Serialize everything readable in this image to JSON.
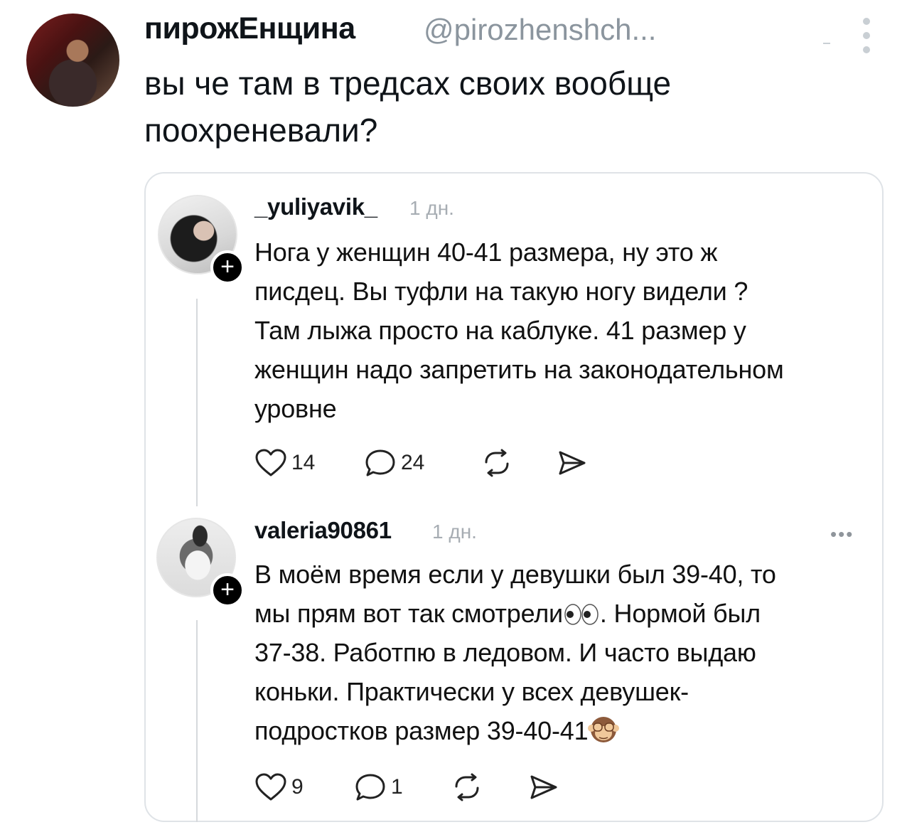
{
  "tweet": {
    "author_name": "пирожЕнщина",
    "author_handle": "@pirozhenshch...",
    "text_line1": "вы че там в тредсах своих вообще",
    "text_line2": "поохреневали?"
  },
  "quote": {
    "replies": [
      {
        "username": "_yuliyavik_",
        "time": "1 дн.",
        "follow_label": "+",
        "lines": [
          "Нога у женщин 40-41 размера, ну это ж",
          "писдец. Вы туфли на такую ногу видели ?",
          "Там лыжа просто на каблуке. 41 размер у",
          "женщин надо запретить на законодательном",
          "уровне"
        ],
        "likes": "14",
        "comments": "24"
      },
      {
        "username": "valeria90861",
        "time": "1 дн.",
        "follow_label": "+",
        "more": "•••",
        "lines": [
          "В моём время если у девушки был 39-40, то",
          "мы прям вот так смотрели",
          ". Нормой был",
          "37-38. Работпю в ледовом. И часто выдаю",
          "коньки. Практически у всех девушек-",
          "подростков размер 39-40-41"
        ],
        "likes": "9",
        "comments": "1"
      }
    ]
  },
  "icons": {
    "more": "more-vertical-icon",
    "like": "heart-icon",
    "comment": "comment-bubble-icon",
    "repost": "repost-icon",
    "share": "send-icon",
    "emoji_eyes": "eyes-emoji-icon",
    "emoji_monkey": "see-no-evil-monkey-icon"
  }
}
